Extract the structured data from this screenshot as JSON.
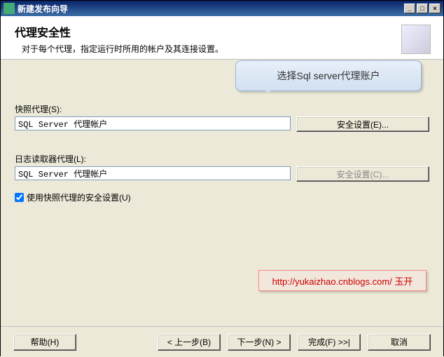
{
  "window": {
    "title": "新建发布向导"
  },
  "header": {
    "title": "代理安全性",
    "subtitle": "对于每个代理，指定运行时所用的帐户及其连接设置。"
  },
  "callout": {
    "text": "选择Sql server代理账户"
  },
  "snapshot": {
    "label": "快照代理(S):",
    "value": "SQL Server 代理帐户",
    "button": "安全设置(E)..."
  },
  "logreader": {
    "label": "日志读取器代理(L):",
    "value": "SQL Server 代理帐户",
    "button": "安全设置(C)..."
  },
  "checkbox": {
    "label": "使用快照代理的安全设置(U)"
  },
  "watermark": {
    "text": "http://yukaizhao.cnblogs.com/ 玉开"
  },
  "footer": {
    "help": "帮助(H)",
    "back": "< 上一步(B)",
    "next": "下一步(N) >",
    "finish": "完成(F) >>|",
    "cancel": "取消"
  }
}
